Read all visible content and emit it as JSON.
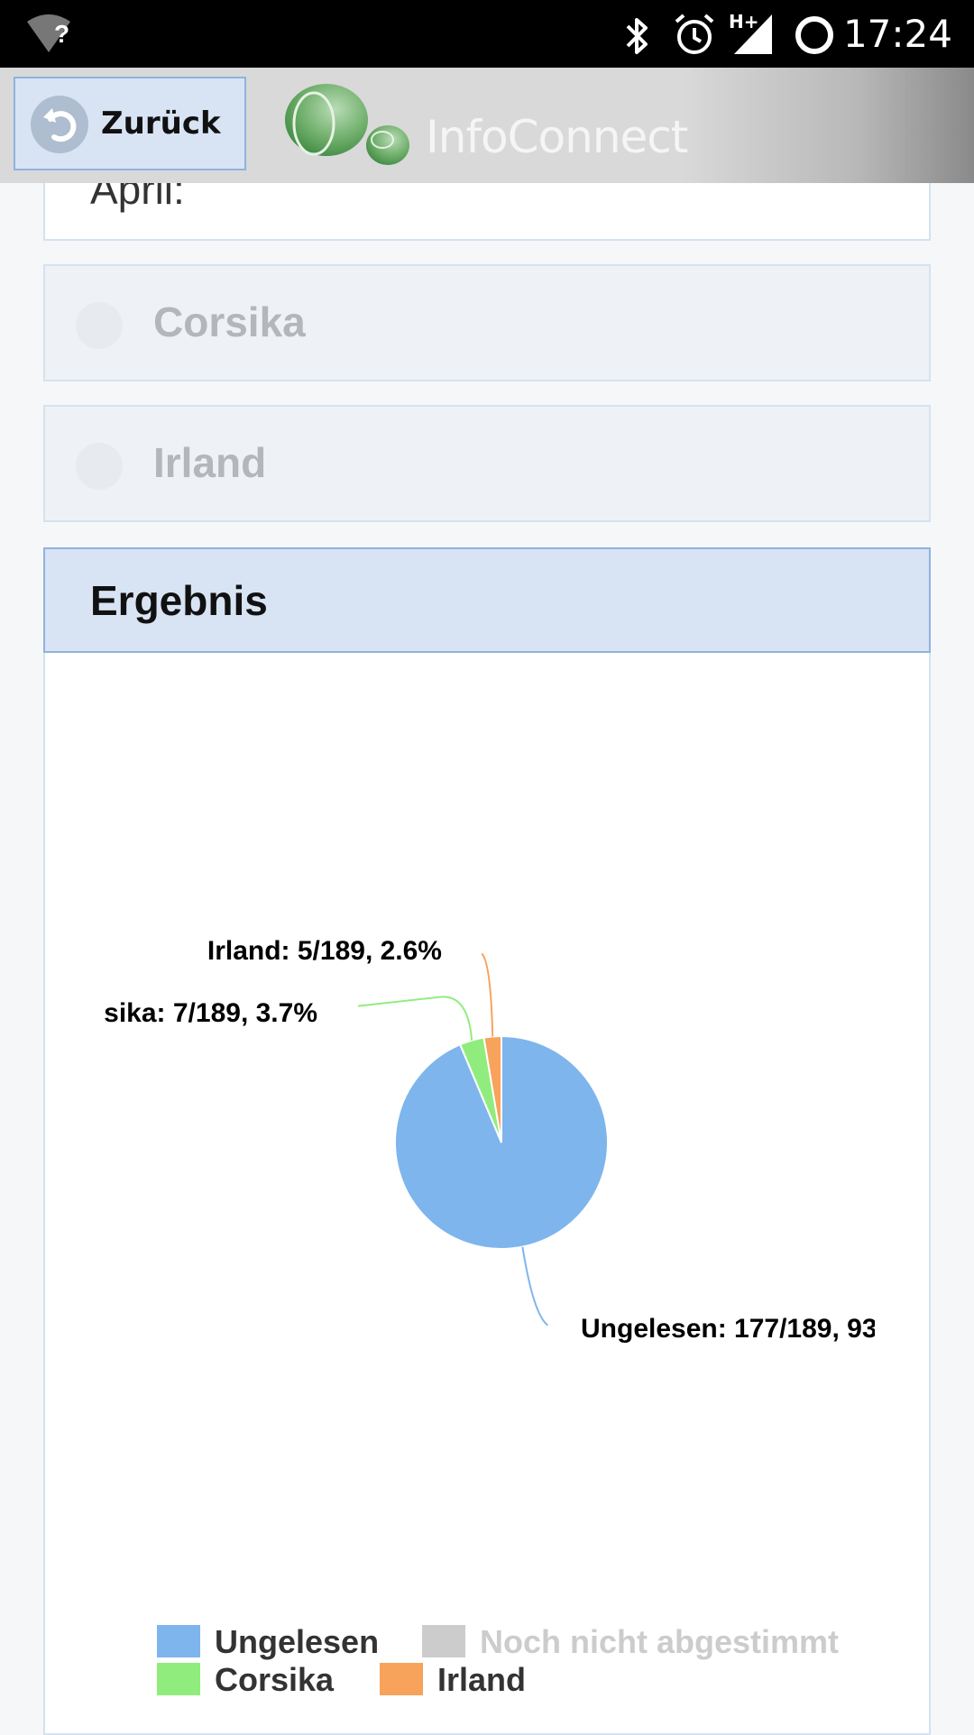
{
  "status_bar": {
    "time": "17:24",
    "wifi_badge": "?",
    "network_type": "H+",
    "icons": [
      "wifi-unknown-icon",
      "bluetooth-icon",
      "alarm-icon",
      "signal-icon",
      "sync-icon"
    ]
  },
  "header": {
    "back_label": "Zurück",
    "app_name": "InfoConnect"
  },
  "poll": {
    "partial_option": "April:",
    "options": [
      {
        "label": "Corsika"
      },
      {
        "label": "Irland"
      }
    ],
    "result_title": "Ergebnis"
  },
  "chart_data": {
    "type": "pie",
    "total": 189,
    "slices": [
      {
        "name": "Ungelesen",
        "value": 177,
        "label": "Ungelesen: 177/189, 93",
        "color": "#7eb5ec"
      },
      {
        "name": "Corsika",
        "value": 7,
        "label": "sika: 7/189, 3.7%",
        "color": "#90ed7d"
      },
      {
        "name": "Irland",
        "value": 5,
        "label": "Irland: 5/189, 2.6%",
        "color": "#f7a35c"
      }
    ],
    "legend": [
      {
        "name": "Ungelesen",
        "color": "#7eb5ec",
        "active": true
      },
      {
        "name": "Noch nicht abgestimmt",
        "color": "#cccccc",
        "active": false
      },
      {
        "name": "Corsika",
        "color": "#90ed7d",
        "active": true
      },
      {
        "name": "Irland",
        "color": "#f7a35c",
        "active": true
      }
    ],
    "legend_placement": "bottom-center"
  }
}
